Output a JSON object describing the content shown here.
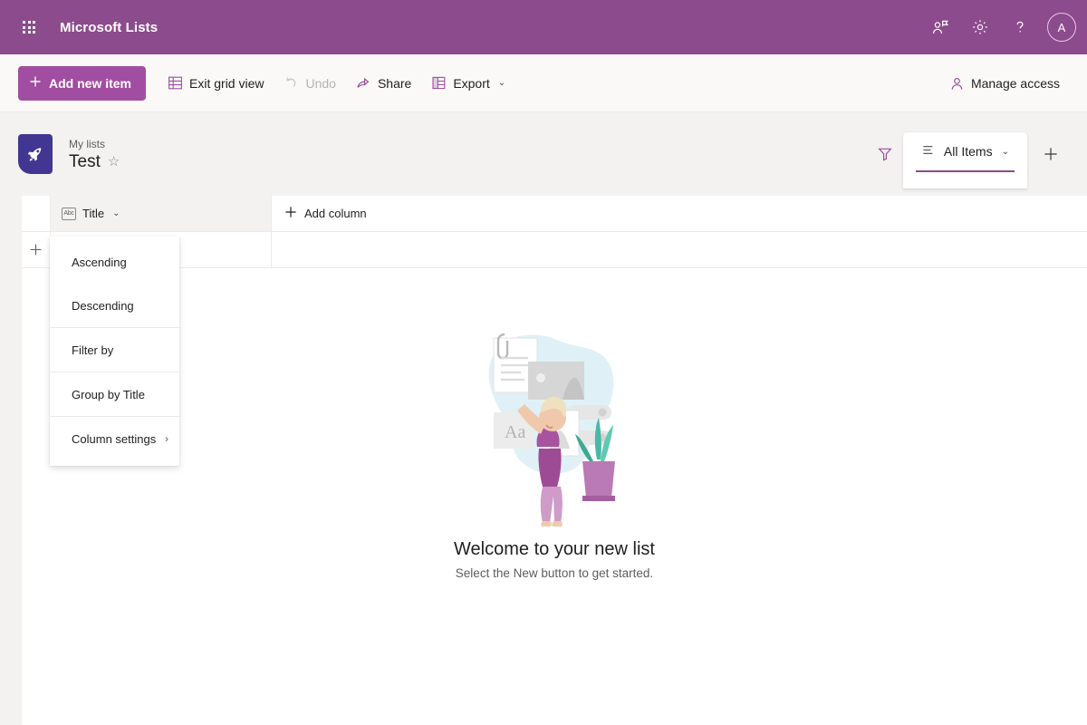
{
  "suite": {
    "waffle_icon": "waffle-grid-icon",
    "title": "Microsoft Lists",
    "icons": [
      {
        "name": "feedback-person-icon",
        "label": "Feedback"
      },
      {
        "name": "gear-icon",
        "label": "Settings"
      },
      {
        "name": "help-question-icon",
        "label": "Help"
      }
    ],
    "avatar_initial": "A",
    "bar_color": "#8c4b8c"
  },
  "command_bar": {
    "add_new_item": "Add new item",
    "add_icon": "plus-icon",
    "items": [
      {
        "label": "Exit grid view",
        "icon": "grid-view-icon",
        "disabled": false
      },
      {
        "label": "Undo",
        "icon": "undo-arrow-icon",
        "disabled": true
      },
      {
        "label": "Share",
        "icon": "share-icon",
        "disabled": false
      },
      {
        "label": "Export",
        "icon": "export-excel-icon",
        "disabled": false,
        "chevron": "⌄"
      }
    ],
    "manage_access": "Manage access",
    "manage_access_icon": "person-icon",
    "accent_color": "#a14da1"
  },
  "list_header": {
    "badge_icon": "rocket-icon",
    "badge_color": "#413792",
    "breadcrumb": "My lists",
    "title": "Test",
    "favorite_icon": "star-outline-icon",
    "filter_icon": "filter-funnel-icon",
    "view_name": "All Items",
    "view_icon": "list-view-icon",
    "view_chevron": "⌄",
    "add_view_icon": "plus-icon",
    "underline_color": "#8c4b8c"
  },
  "grid": {
    "column": {
      "name": "Title",
      "type_icon_text": "Abc",
      "chevron": "⌄"
    },
    "add_column": "Add column",
    "add_column_icon": "plus-icon",
    "new_row_icon": "plus-icon"
  },
  "context_menu": {
    "items": [
      {
        "label": "Ascending",
        "submenu": false
      },
      {
        "label": "Descending",
        "submenu": false
      },
      {
        "label": "Filter by",
        "submenu": false
      },
      {
        "label": "Group by Title",
        "submenu": false
      },
      {
        "label": "Column settings",
        "submenu": true,
        "chevron": "›"
      }
    ]
  },
  "empty_state": {
    "illustration": "person-arranging-list-illustration",
    "title": "Welcome to your new list",
    "subtitle": "Select the New button to get started."
  }
}
